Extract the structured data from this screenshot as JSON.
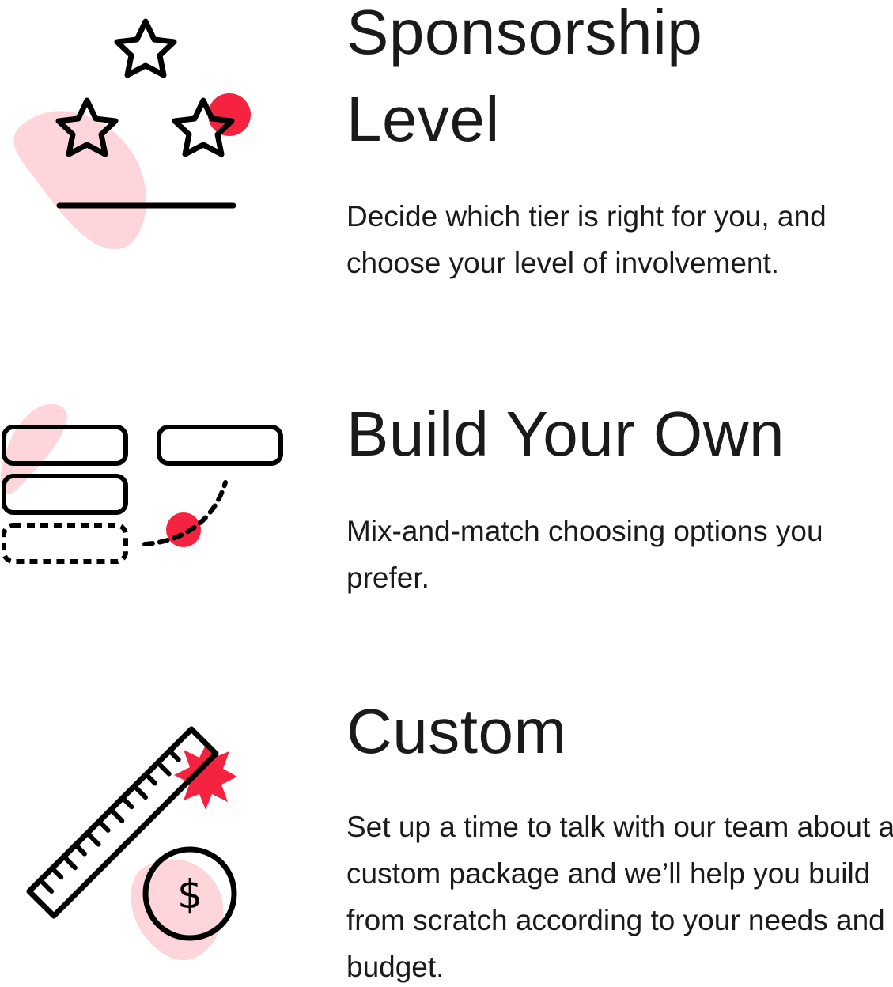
{
  "colors": {
    "accent": "#f5233f",
    "blob": "#fdd5da",
    "stroke": "#000000",
    "text": "#1a1a1a"
  },
  "sections": [
    {
      "title": "Sponsorship Level",
      "title_line1": "Sponsorship",
      "title_line2": "Level",
      "description": "Decide which tier is right for you, and choose your level of involvement.",
      "icon": "stars-icon"
    },
    {
      "title": "Build Your Own",
      "description": "Mix-and-match choosing options you prefer.",
      "icon": "build-blocks-icon"
    },
    {
      "title": "Custom",
      "description": "Set up a time to talk with our team about a custom package and we’ll help you build from scratch according to your needs and budget.",
      "icon": "ruler-dollar-icon"
    }
  ]
}
